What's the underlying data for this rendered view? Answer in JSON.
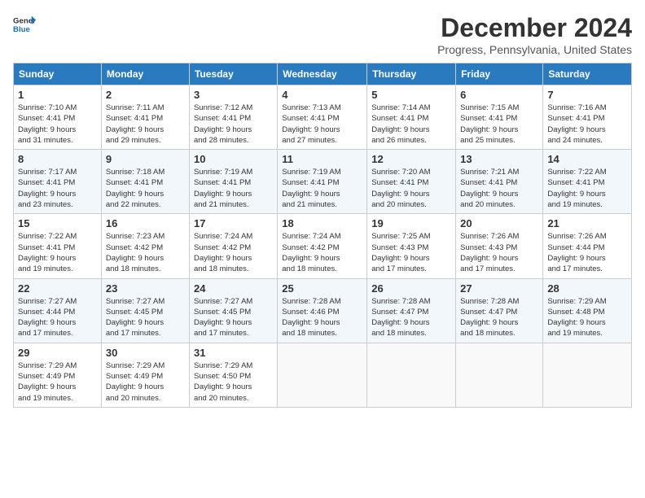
{
  "header": {
    "logo_line1": "General",
    "logo_line2": "Blue",
    "month": "December 2024",
    "location": "Progress, Pennsylvania, United States"
  },
  "weekdays": [
    "Sunday",
    "Monday",
    "Tuesday",
    "Wednesday",
    "Thursday",
    "Friday",
    "Saturday"
  ],
  "weeks": [
    [
      {
        "day": "1",
        "info": "Sunrise: 7:10 AM\nSunset: 4:41 PM\nDaylight: 9 hours\nand 31 minutes."
      },
      {
        "day": "2",
        "info": "Sunrise: 7:11 AM\nSunset: 4:41 PM\nDaylight: 9 hours\nand 29 minutes."
      },
      {
        "day": "3",
        "info": "Sunrise: 7:12 AM\nSunset: 4:41 PM\nDaylight: 9 hours\nand 28 minutes."
      },
      {
        "day": "4",
        "info": "Sunrise: 7:13 AM\nSunset: 4:41 PM\nDaylight: 9 hours\nand 27 minutes."
      },
      {
        "day": "5",
        "info": "Sunrise: 7:14 AM\nSunset: 4:41 PM\nDaylight: 9 hours\nand 26 minutes."
      },
      {
        "day": "6",
        "info": "Sunrise: 7:15 AM\nSunset: 4:41 PM\nDaylight: 9 hours\nand 25 minutes."
      },
      {
        "day": "7",
        "info": "Sunrise: 7:16 AM\nSunset: 4:41 PM\nDaylight: 9 hours\nand 24 minutes."
      }
    ],
    [
      {
        "day": "8",
        "info": "Sunrise: 7:17 AM\nSunset: 4:41 PM\nDaylight: 9 hours\nand 23 minutes."
      },
      {
        "day": "9",
        "info": "Sunrise: 7:18 AM\nSunset: 4:41 PM\nDaylight: 9 hours\nand 22 minutes."
      },
      {
        "day": "10",
        "info": "Sunrise: 7:19 AM\nSunset: 4:41 PM\nDaylight: 9 hours\nand 21 minutes."
      },
      {
        "day": "11",
        "info": "Sunrise: 7:19 AM\nSunset: 4:41 PM\nDaylight: 9 hours\nand 21 minutes."
      },
      {
        "day": "12",
        "info": "Sunrise: 7:20 AM\nSunset: 4:41 PM\nDaylight: 9 hours\nand 20 minutes."
      },
      {
        "day": "13",
        "info": "Sunrise: 7:21 AM\nSunset: 4:41 PM\nDaylight: 9 hours\nand 20 minutes."
      },
      {
        "day": "14",
        "info": "Sunrise: 7:22 AM\nSunset: 4:41 PM\nDaylight: 9 hours\nand 19 minutes."
      }
    ],
    [
      {
        "day": "15",
        "info": "Sunrise: 7:22 AM\nSunset: 4:41 PM\nDaylight: 9 hours\nand 19 minutes."
      },
      {
        "day": "16",
        "info": "Sunrise: 7:23 AM\nSunset: 4:42 PM\nDaylight: 9 hours\nand 18 minutes."
      },
      {
        "day": "17",
        "info": "Sunrise: 7:24 AM\nSunset: 4:42 PM\nDaylight: 9 hours\nand 18 minutes."
      },
      {
        "day": "18",
        "info": "Sunrise: 7:24 AM\nSunset: 4:42 PM\nDaylight: 9 hours\nand 18 minutes."
      },
      {
        "day": "19",
        "info": "Sunrise: 7:25 AM\nSunset: 4:43 PM\nDaylight: 9 hours\nand 17 minutes."
      },
      {
        "day": "20",
        "info": "Sunrise: 7:26 AM\nSunset: 4:43 PM\nDaylight: 9 hours\nand 17 minutes."
      },
      {
        "day": "21",
        "info": "Sunrise: 7:26 AM\nSunset: 4:44 PM\nDaylight: 9 hours\nand 17 minutes."
      }
    ],
    [
      {
        "day": "22",
        "info": "Sunrise: 7:27 AM\nSunset: 4:44 PM\nDaylight: 9 hours\nand 17 minutes."
      },
      {
        "day": "23",
        "info": "Sunrise: 7:27 AM\nSunset: 4:45 PM\nDaylight: 9 hours\nand 17 minutes."
      },
      {
        "day": "24",
        "info": "Sunrise: 7:27 AM\nSunset: 4:45 PM\nDaylight: 9 hours\nand 17 minutes."
      },
      {
        "day": "25",
        "info": "Sunrise: 7:28 AM\nSunset: 4:46 PM\nDaylight: 9 hours\nand 18 minutes."
      },
      {
        "day": "26",
        "info": "Sunrise: 7:28 AM\nSunset: 4:47 PM\nDaylight: 9 hours\nand 18 minutes."
      },
      {
        "day": "27",
        "info": "Sunrise: 7:28 AM\nSunset: 4:47 PM\nDaylight: 9 hours\nand 18 minutes."
      },
      {
        "day": "28",
        "info": "Sunrise: 7:29 AM\nSunset: 4:48 PM\nDaylight: 9 hours\nand 19 minutes."
      }
    ],
    [
      {
        "day": "29",
        "info": "Sunrise: 7:29 AM\nSunset: 4:49 PM\nDaylight: 9 hours\nand 19 minutes."
      },
      {
        "day": "30",
        "info": "Sunrise: 7:29 AM\nSunset: 4:49 PM\nDaylight: 9 hours\nand 20 minutes."
      },
      {
        "day": "31",
        "info": "Sunrise: 7:29 AM\nSunset: 4:50 PM\nDaylight: 9 hours\nand 20 minutes."
      },
      null,
      null,
      null,
      null
    ]
  ]
}
